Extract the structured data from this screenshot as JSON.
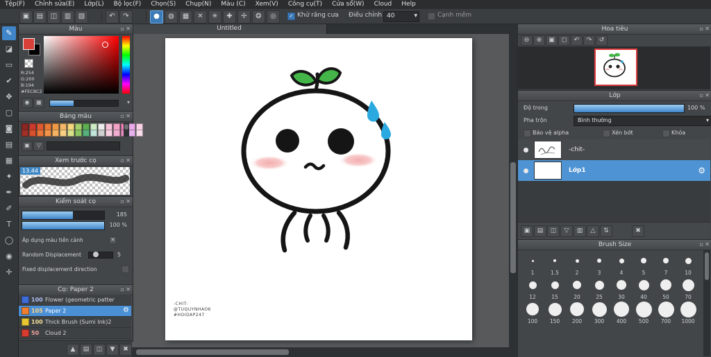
{
  "icons": {
    "close": "✕",
    "popout": "▫",
    "dropdown": "▾",
    "undo": "↶",
    "redo": "↷",
    "gear": "⚙",
    "check": "✓",
    "cross": "✕"
  },
  "menubar": {
    "items": [
      "Tệp(F)",
      "Chỉnh sửa(E)",
      "Lớp(L)",
      "Bộ lọc(F)",
      "Chọn(S)",
      "Chụp(N)",
      "Màu (C)",
      "Xem(V)",
      "Công cụ(T)",
      "Cửa sổ(W)",
      "Cloud",
      "Help"
    ]
  },
  "toolbar": {
    "file_icons": [
      {
        "name": "new-canvas-icon",
        "glyph": "▣"
      },
      {
        "name": "open-icon",
        "glyph": "▤"
      },
      {
        "name": "save-icon",
        "glyph": "◫"
      },
      {
        "name": "export-icon",
        "glyph": "▥"
      },
      {
        "name": "clipboard-icon",
        "glyph": "▧"
      }
    ],
    "brush_icons": [
      {
        "name": "brush-tip-circle-icon",
        "glyph": "●",
        "selected": true
      },
      {
        "name": "brush-tip-soft-icon",
        "glyph": "◍"
      },
      {
        "name": "grid-icon",
        "glyph": "▦"
      },
      {
        "name": "snap-off-icon",
        "glyph": "✕"
      },
      {
        "name": "snap-parallel-icon",
        "glyph": "✳"
      },
      {
        "name": "snap-cross-icon",
        "glyph": "✚"
      },
      {
        "name": "snap-vanishing-icon",
        "glyph": "✢"
      },
      {
        "name": "snap-radial-icon",
        "glyph": "❂"
      },
      {
        "name": "snap-ellipse-icon",
        "glyph": "◎"
      }
    ],
    "antialias": {
      "label": "Khử răng cưa",
      "checked": true
    },
    "adjust": {
      "label": "Điều chỉnh",
      "value": "40"
    },
    "soft_edge": {
      "label": "Cạnh mềm",
      "checked": false
    }
  },
  "toolstrip": {
    "tools": [
      {
        "name": "brush-tool",
        "glyph": "✎",
        "selected": true
      },
      {
        "name": "eraser-tool",
        "glyph": "◪"
      },
      {
        "name": "select-rect-tool",
        "glyph": "▭"
      },
      {
        "name": "select-pen-tool",
        "glyph": "✔"
      },
      {
        "name": "move-tool",
        "glyph": "✥"
      },
      {
        "name": "transform-tool",
        "glyph": "▢"
      },
      {
        "name": "bucket-tool",
        "glyph": "◙"
      },
      {
        "name": "gradient-tool",
        "glyph": "▤"
      },
      {
        "name": "auto-select-tool",
        "glyph": "▦"
      },
      {
        "name": "wand-tool",
        "glyph": "✦"
      },
      {
        "name": "pen-tool",
        "glyph": "✒"
      },
      {
        "name": "correction-tool",
        "glyph": "✐"
      },
      {
        "name": "text-tool",
        "glyph": "T"
      },
      {
        "name": "shape-tool",
        "glyph": "◯"
      },
      {
        "name": "eyedropper-tool",
        "glyph": "◉"
      },
      {
        "name": "hand-tool",
        "glyph": "✛"
      }
    ]
  },
  "canvas": {
    "tab_title": "Untitled",
    "signature": [
      "-CHIT-",
      "@TUQUYNHAO6",
      "#HOIDAP247"
    ]
  },
  "panels": {
    "color": {
      "title": "Màu",
      "r": "R:254",
      "g": "G:200",
      "b": "B:194",
      "hex": "#FEC8C2",
      "foreground": "#d84038",
      "background": "#000000",
      "buttons": [
        {
          "name": "eyedropper-small-icon",
          "glyph": "◉"
        },
        {
          "name": "color-grid-icon",
          "glyph": "▦"
        }
      ]
    },
    "palette": {
      "title": "Bảng màu",
      "row1": [
        "#8c2723",
        "#cc3a2e",
        "#e05a31",
        "#ea7a35",
        "#f09a46",
        "#f4b868",
        "#f6d67e",
        "#a8cf6e",
        "#5fae52",
        "#cfe9c4",
        "#ececec",
        "#f6c3d8",
        "#f2a3c6",
        "#ee82b4",
        "#ecaae6",
        "#f8d2e4"
      ],
      "row2": [
        "#a03028",
        "#d8502e",
        "#e8763a",
        "#f09448",
        "#f4b262",
        "#f8d083",
        "#d8e08a",
        "#8cc463",
        "#58b07e",
        "#bfe4da",
        "#cfcfcf",
        "#f6cfe0",
        "#f0aed2",
        "#ea8ec2",
        "#e6b2ec",
        "#f8dcec"
      ],
      "buttons": [
        {
          "name": "add-color-icon",
          "glyph": "▣"
        },
        {
          "name": "delete-color-icon",
          "glyph": "▽"
        }
      ]
    },
    "brush_preview": {
      "title": "Xem trước cọ",
      "size_badge": "13.44"
    },
    "brush_control": {
      "title": "Kiểm soát cọ",
      "size_value": "185",
      "opacity_value": "100 %",
      "foreground_label": "Áp dụng màu tiền cảnh",
      "random_label": "Random Displacement",
      "random_value": "5",
      "fixed_label": "Fixed displacement direction"
    },
    "brush_list": {
      "title": "Cọ: Paper 2",
      "items": [
        {
          "size": "100",
          "name": "Flower (geometric patter",
          "color": "#3d6bd8",
          "num_color": "#aebef2"
        },
        {
          "size": "105",
          "name": "Paper 2",
          "color": "#f08030",
          "num_color": "#ffd27f",
          "selected": true
        },
        {
          "size": "100",
          "name": "Thick Brush (Sumi Ink)2",
          "color": "#e8c832",
          "num_color": "#f2e09a"
        },
        {
          "size": "50",
          "name": "Cloud 2",
          "color": "#d83c30",
          "num_color": "#f2a59e"
        }
      ]
    },
    "navigator": {
      "title": "Hoa tiêu",
      "icons": [
        {
          "name": "zoom-out-icon",
          "glyph": "⊖"
        },
        {
          "name": "zoom-in-icon",
          "glyph": "⊕"
        },
        {
          "name": "zoom-fit-icon",
          "glyph": "▣"
        },
        {
          "name": "zoom-100-icon",
          "glyph": "◻"
        },
        {
          "name": "rotate-left-icon",
          "glyph": "↶"
        },
        {
          "name": "rotate-right-icon",
          "glyph": "↷"
        },
        {
          "name": "reset-view-icon",
          "glyph": "↺"
        }
      ]
    },
    "layers": {
      "title": "Lớp",
      "opacity_label": "Độ trong",
      "opacity_value": "100 %",
      "blend_label": "Pha trộn",
      "blend_value": "Bình thường",
      "checkbox1": "Bảo vệ alpha",
      "checkbox2": "Xén bớt",
      "checkbox3": "Khóa",
      "items": [
        {
          "name": "-chit-",
          "thumb": "signature"
        },
        {
          "name": "Lớp1",
          "thumb": "checker",
          "selected": true
        }
      ],
      "toolbar_icons": [
        {
          "name": "add-layer-icon",
          "glyph": "▣"
        },
        {
          "name": "add-folder-icon",
          "glyph": "▤"
        },
        {
          "name": "duplicate-layer-icon",
          "glyph": "◫"
        },
        {
          "name": "transfer-layer-icon",
          "glyph": "▽"
        },
        {
          "name": "merge-layer-icon",
          "glyph": "▥"
        },
        {
          "name": "move-up-icon",
          "glyph": "△"
        },
        {
          "name": "reorder-icon",
          "glyph": "⇅"
        },
        {
          "name": "delete-layer-icon",
          "glyph": "✖"
        }
      ]
    },
    "brush_size": {
      "title": "Brush Size",
      "sizes": [
        "1",
        "1.5",
        "2",
        "3",
        "4",
        "5",
        "7",
        "10",
        "12",
        "15",
        "20",
        "25",
        "30",
        "40",
        "50",
        "70",
        "100",
        "150",
        "200",
        "300",
        "400",
        "500",
        "700",
        "1000"
      ]
    }
  },
  "bottom_bar": {
    "icons": [
      {
        "name": "upload-brush-icon",
        "glyph": "▲"
      },
      {
        "name": "brush-folder-icon",
        "glyph": "▤"
      },
      {
        "name": "save-brush-icon",
        "glyph": "◫"
      },
      {
        "name": "download-brush-icon",
        "glyph": "▼"
      },
      {
        "name": "delete-brush-icon",
        "glyph": "✖"
      }
    ]
  }
}
